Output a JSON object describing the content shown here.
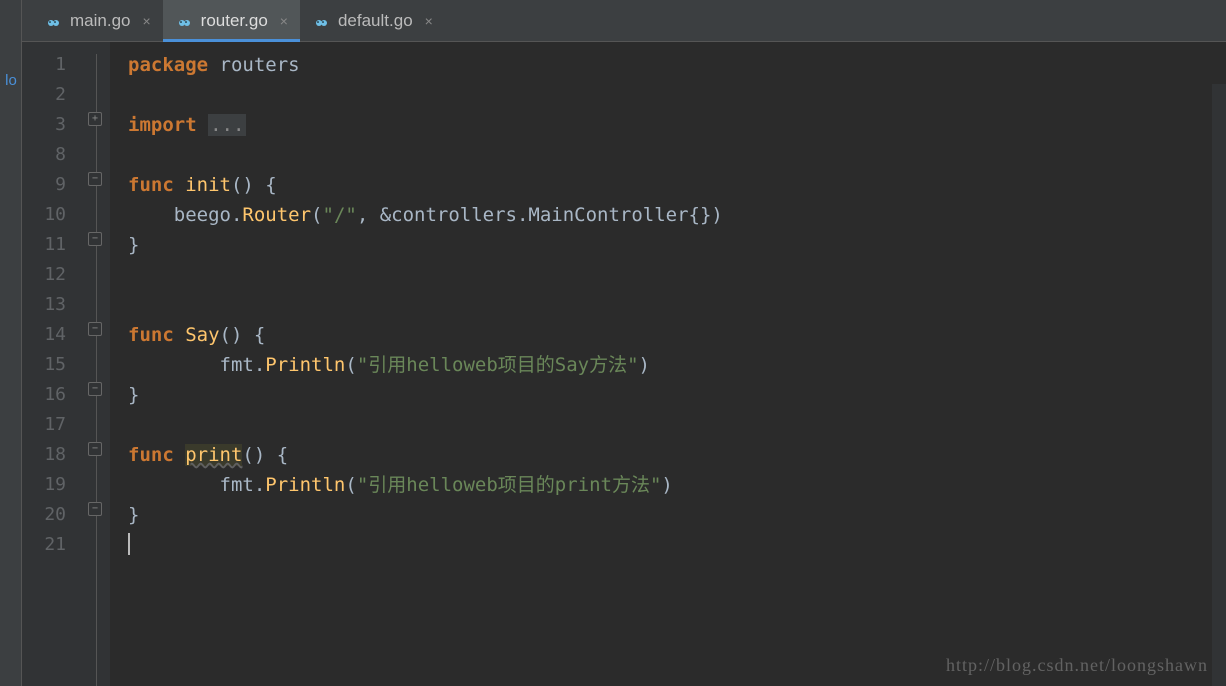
{
  "left_strip": {
    "label": "lo"
  },
  "tabs": [
    {
      "label": "main.go",
      "active": false
    },
    {
      "label": "router.go",
      "active": true
    },
    {
      "label": "default.go",
      "active": false
    }
  ],
  "gutter_lines": [
    "1",
    "2",
    "3",
    "8",
    "9",
    "10",
    "11",
    "12",
    "13",
    "14",
    "15",
    "16",
    "17",
    "18",
    "19",
    "20",
    "21"
  ],
  "code": {
    "l1_kw": "package",
    "l1_ident": "routers",
    "l3_kw": "import",
    "l3_folded": "...",
    "l9_kw": "func",
    "l9_name": "init",
    "l9_tail": "() {",
    "l10_a": "beego.",
    "l10_b": "Router",
    "l10_c": "(",
    "l10_str": "\"/\"",
    "l10_d": ", &controllers.MainController{})",
    "l11": "}",
    "l14_kw": "func",
    "l14_name": "Say",
    "l14_tail": "() {",
    "l15_a": "fmt.",
    "l15_b": "Println",
    "l15_c": "(",
    "l15_str": "\"引用helloweb项目的Say方法\"",
    "l15_d": ")",
    "l16": "}",
    "l18_kw": "func",
    "l18_name": "print",
    "l18_tail": "() {",
    "l19_a": "fmt.",
    "l19_b": "Println",
    "l19_c": "(",
    "l19_str": "\"引用helloweb项目的print方法\"",
    "l19_d": ")",
    "l20": "}"
  },
  "watermark": "http://blog.csdn.net/loongshawn"
}
